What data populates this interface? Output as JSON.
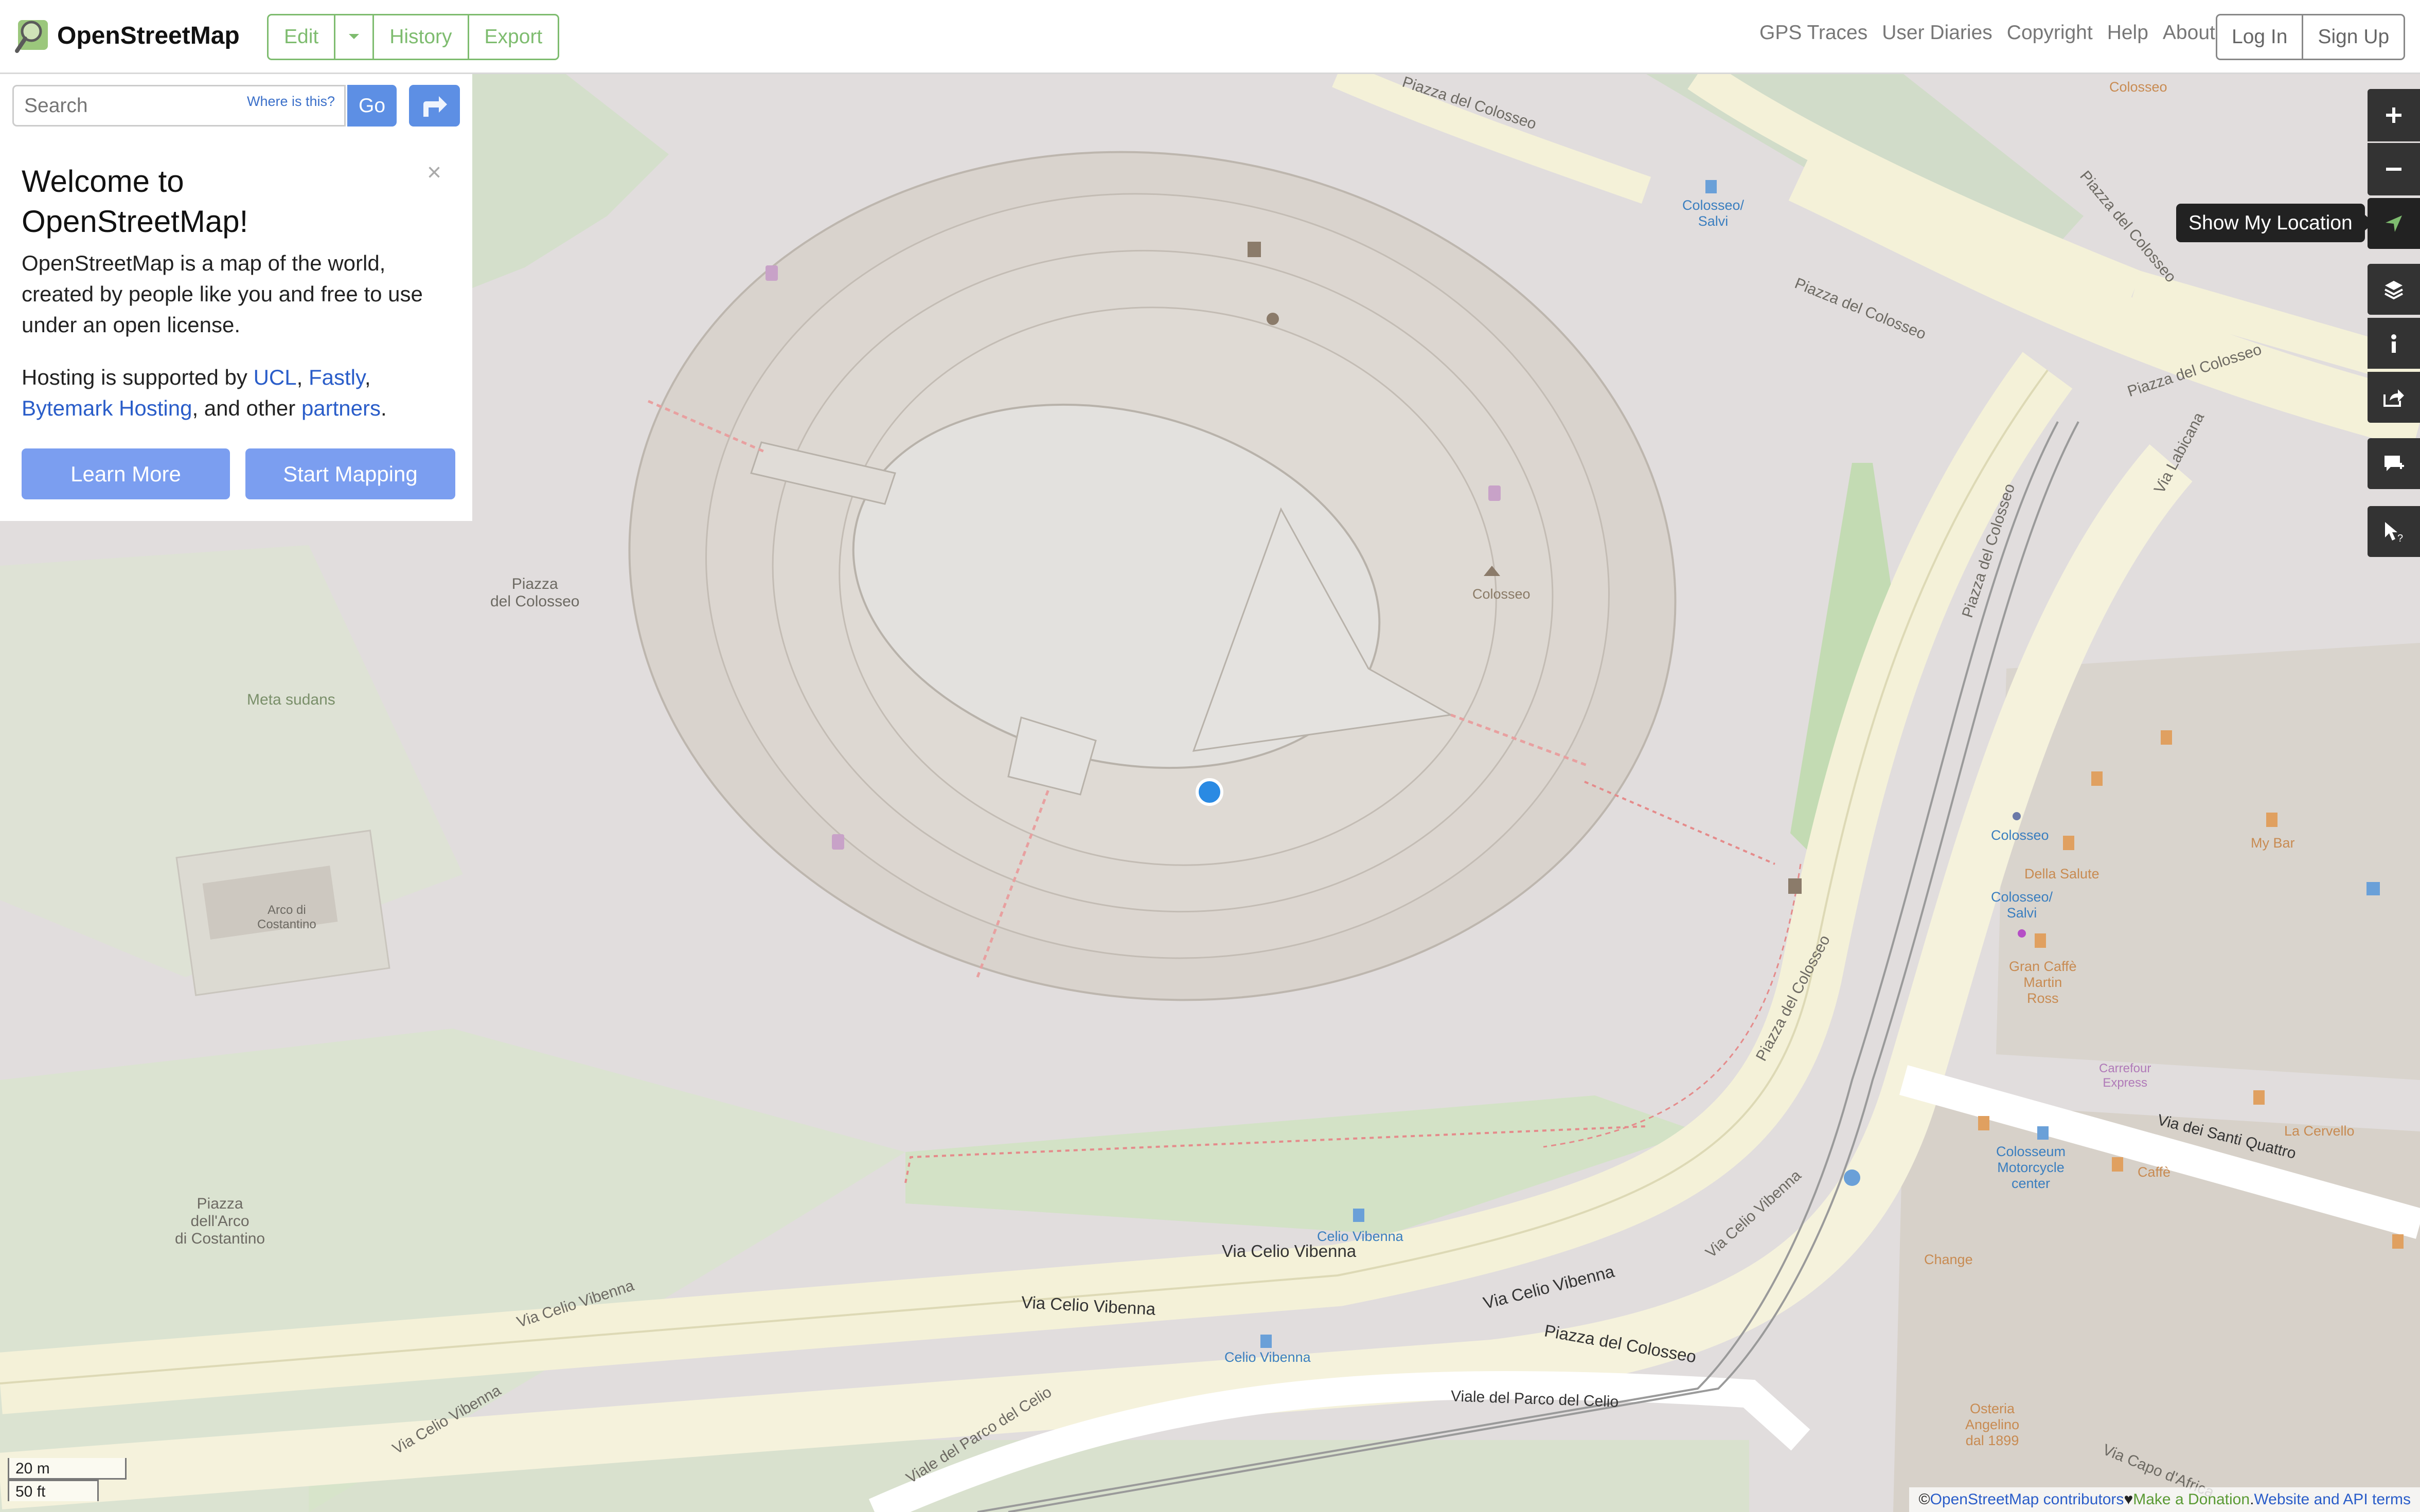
{
  "header": {
    "logo_text": "OpenStreetMap",
    "edit_label": "Edit",
    "history_label": "History",
    "export_label": "Export",
    "nav": [
      "GPS Traces",
      "User Diaries",
      "Copyright",
      "Help",
      "About"
    ],
    "login_label": "Log In",
    "signup_label": "Sign Up"
  },
  "search": {
    "placeholder": "Search",
    "where_label": "Where is this?",
    "go_label": "Go"
  },
  "welcome": {
    "title": "Welcome to OpenStreetMap!",
    "intro": "OpenStreetMap is a map of the world, created by people like you and free to use under an open license.",
    "hosting_prefix": "Hosting is supported by ",
    "ucl": "UCL",
    "sep1": ", ",
    "fastly": "Fastly",
    "sep2": ",",
    "bytemark": "Bytemark Hosting",
    "and_other": ", and other ",
    "partners": "partners",
    "period": ".",
    "learn_more": "Learn More",
    "start_mapping": "Start Mapping",
    "close": "×"
  },
  "controls": {
    "tooltip": "Show My Location"
  },
  "map_labels": {
    "piazza_colosseo_nw": "Piazza\ndel Colosseo",
    "meta_sudans": "Meta sudans",
    "arco_costantino": "Arco di\nCostantino",
    "piazza_arco": "Piazza\ndell'Arco\ndi Costantino",
    "colosseo": "Colosseo",
    "piazza_del_colosseo_top": "Piazza del Colosseo",
    "piazza_del_colosseo_ne": "Piazza del Colosseo",
    "piazza_del_colosseo_e": "Piazza del Colosseo",
    "piazza_del_colosseo_ramp": "Piazza del Colosseo",
    "piazza_del_colosseo_mid": "Piazza del Colosseo",
    "piazza_del_colosseo_bottom": "Piazza del Colosseo",
    "piazza_del_colosseo_vert": "Piazza del Colosseo",
    "via_celio_vibenna_1": "Via Celio Vibenna",
    "via_celio_vibenna_2": "Via Celio Vibenna",
    "via_celio_vibenna_3": "Via Celio Vibenna",
    "via_celio_vibenna_4": "Via Celio Vibenna",
    "via_celio_vibenna_5": "Via Celio Vibenna",
    "via_celio_vibenna_6": "Via Celio Vibenna",
    "viale_parco_celio": "Viale del Parco del Celio",
    "viale_parco_celio_2": "Viale del Parco del Celio",
    "via_labicana": "Via Labicana",
    "via_santi_quattro": "Via dei Santi Quattro",
    "via_capo_africa": "Via Capo d'Africa",
    "celio_vibenna_stop_1": "Celio Vibenna",
    "celio_vibenna_stop_2": "Celio Vibenna",
    "colosseo_salvi": "Colosseo/\nSalvi",
    "colosseo_salvi_2": "Colosseo/\nSalvi",
    "colosseo_stop": "Colosseo",
    "della_salute": "Della Salute",
    "gran_caffe": "Gran Caffè\nMartin\nRoss",
    "my_bar": "My Bar",
    "change": "Change",
    "colosseum_center": "Colosseum\nMotorcycle\ncenter",
    "carrefour": "Carrefour\nExpress",
    "osteria": "Osteria\nAngelino\ndal 1899",
    "la_cervello": "La Cervello",
    "caffe": "Caffè",
    "colosseo_top": "Colosseo"
  },
  "scale": {
    "metric": "20 m",
    "imperial": "50 ft"
  },
  "attribution": {
    "copy": "© ",
    "contributors": "OpenStreetMap contributors",
    "heart": " ♥ ",
    "donation": "Make a Donation",
    "dot": ". ",
    "terms": "Website and API terms"
  },
  "colors": {
    "accent_green": "#7ebc6f",
    "button_blue": "#7b9ef0",
    "link_blue": "#2a5dc9",
    "control_dark": "#333333",
    "location_dot": "#2a8ae3"
  }
}
